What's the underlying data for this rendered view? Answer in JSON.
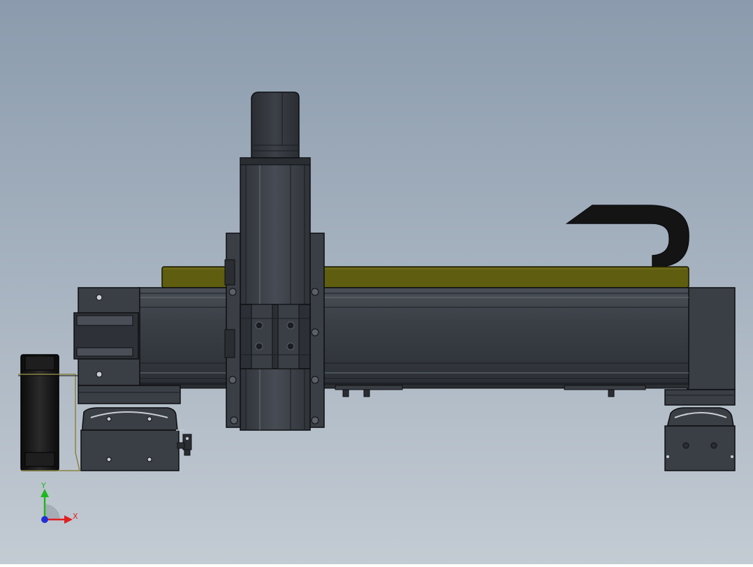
{
  "triad": {
    "y_label": "Y",
    "x_label": "X",
    "colors": {
      "y": "#1fb81f",
      "x": "#e02020",
      "z": "#2030d8"
    }
  },
  "colors": {
    "background_top": "#8b9bad",
    "background_bottom": "#c3cbd3",
    "body_dark": "#2e3238",
    "body_mid": "#3e434a",
    "body_light": "#555b63",
    "cable_cover": "#5f5d0f",
    "cable_carrier": "#141414",
    "edge": "#0d0f11"
  }
}
